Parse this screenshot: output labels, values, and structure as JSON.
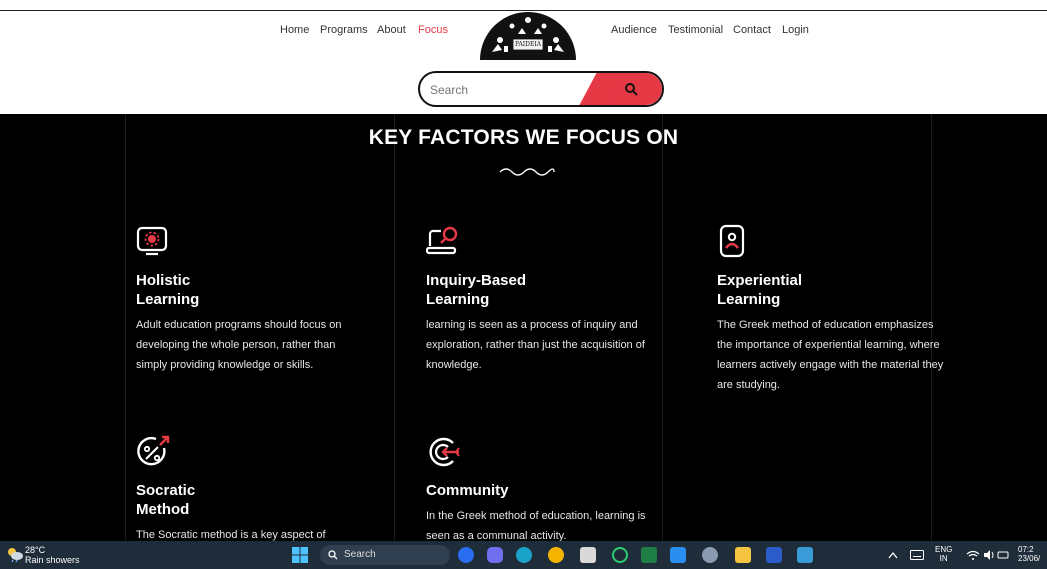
{
  "nav": {
    "left": [
      "Home",
      "Programs",
      "About",
      "Focus"
    ],
    "right": [
      "Audience",
      "Testimonial",
      "Contact",
      "Login"
    ],
    "active": "Focus",
    "logo_text": "PAIDEIA"
  },
  "search": {
    "placeholder": "Search"
  },
  "section": {
    "title": "KEY FACTORS WE FOCUS ON",
    "cards": [
      {
        "title_line1": "Holistic",
        "title_line2": "Learning",
        "text": "Adult education programs should focus on developing the whole person, rather than simply providing knowledge or skills.",
        "icon": "monitor-gear-icon"
      },
      {
        "title_line1": "Inquiry-Based",
        "title_line2": "Learning",
        "text": "learning is seen as a process of inquiry and exploration, rather than just the acquisition of knowledge.",
        "icon": "laptop-search-icon"
      },
      {
        "title_line1": "Experiential",
        "title_line2": "Learning",
        "text": "The Greek method of education emphasizes the importance of experiential learning, where learners actively engage with the material they are studying.",
        "icon": "user-badge-icon"
      },
      {
        "title_line1": "Socratic",
        "title_line2": "Method",
        "text": "The Socratic method is a key aspect of",
        "icon": "percent-arrow-icon"
      },
      {
        "title_line1": "Community",
        "title_line2": "",
        "text": "In the Greek method of education, learning is seen as a communal activity.",
        "icon": "target-arrow-icon"
      }
    ]
  },
  "taskbar": {
    "temp": "28°C",
    "weather": "Rain showers",
    "search": "Search",
    "lang1": "ENG",
    "lang2": "IN",
    "time": "07:2",
    "date": "23/06/"
  },
  "colors": {
    "accent": "#e63946",
    "section_bg": "#000000",
    "taskbar_bg": "#1f2d3a"
  }
}
